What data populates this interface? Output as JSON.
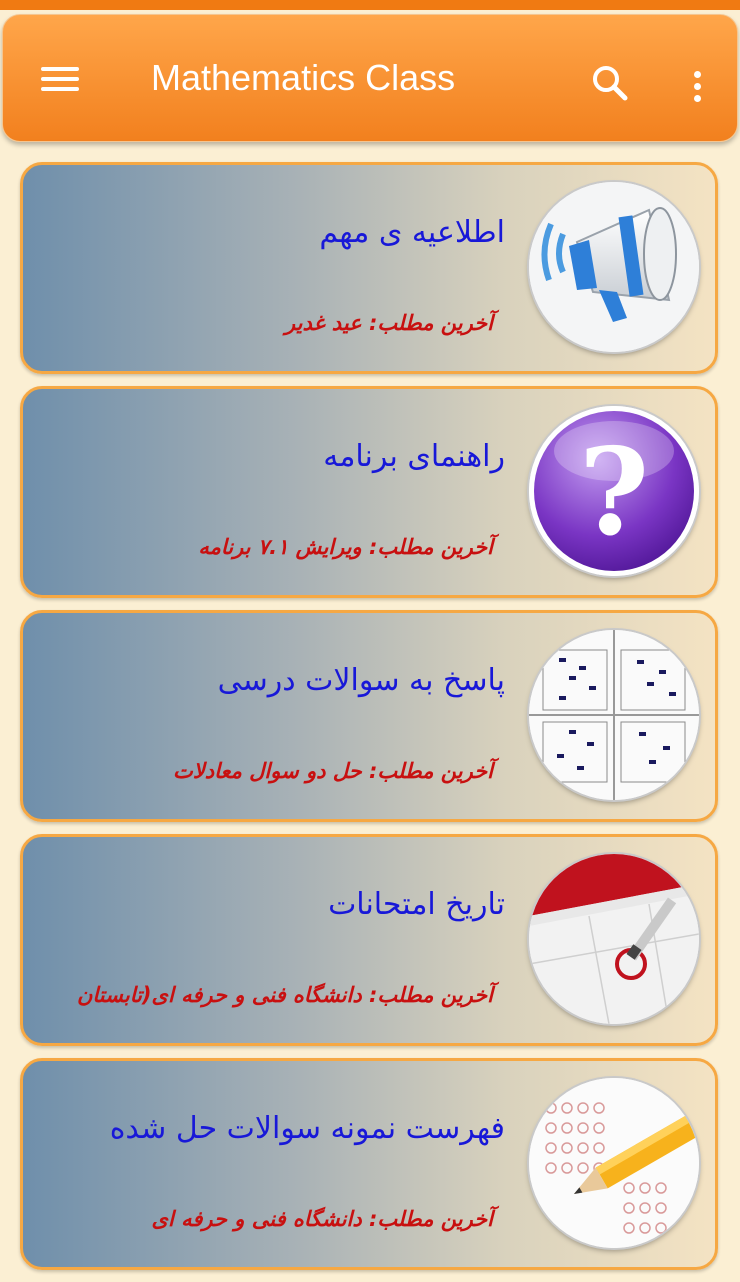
{
  "appbar": {
    "title": "Mathematics Class",
    "menu_icon": "hamburger-menu-icon",
    "search_icon": "search-icon",
    "more_icon": "more-vert-icon"
  },
  "colors": {
    "appbar": "#f2801e",
    "card_border": "#f6a843",
    "title_text": "#1818d8",
    "subtitle_text": "#c81010",
    "background": "#fbefd3"
  },
  "categories": [
    {
      "title": "اطلاعیه ی مهم",
      "subtitle": "آخرین مطلب: عید غدیر",
      "icon": "megaphone-icon"
    },
    {
      "title": "راهنمای برنامه",
      "subtitle": "آخرین مطلب: ویرایش ۷.۱ برنامه",
      "icon": "question-mark-icon"
    },
    {
      "title": "پاسخ به سوالات درسی",
      "subtitle": "آخرین مطلب: حل دو سوال معادلات",
      "icon": "answer-sheet-icon"
    },
    {
      "title": "تاریخ امتحانات",
      "subtitle": "آخرین مطلب: دانشگاه فنی و حرفه ای(تابستان",
      "icon": "calendar-icon"
    },
    {
      "title": "فهرست نمونه سوالات حل شده",
      "subtitle": "آخرین مطلب: دانشگاه فنی و حرفه ای",
      "icon": "pencil-test-icon"
    }
  ]
}
